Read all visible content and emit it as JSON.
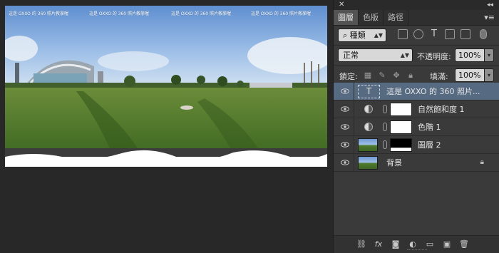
{
  "canvas": {
    "overlay_texts": [
      "這是 OXXO 的 360 照片教學喔",
      "這是 OXXO 的 360 照片教學喔",
      "這是 OXXO 的 360 照片教學喔",
      "這是 OXXO 的 360 照片教學喔"
    ]
  },
  "panel": {
    "close_glyph": "✕",
    "collapse_glyph": "◂◂",
    "menu_glyph": "▾≡",
    "tabs": [
      {
        "label": "圖層",
        "active": true
      },
      {
        "label": "色版",
        "active": false
      },
      {
        "label": "路徑",
        "active": false
      }
    ],
    "filter": {
      "label": "種類",
      "search_glyph": "⌕"
    },
    "blend_mode": {
      "value": "正常",
      "opacity_label": "不透明度:",
      "opacity_value": "100%"
    },
    "lock": {
      "label": "鎖定:",
      "fill_label": "填滿:",
      "fill_value": "100%"
    },
    "layers": [
      {
        "name": "這是 OXXO 的 360 照片...",
        "kind": "text",
        "selected": true,
        "visible": true
      },
      {
        "name": "自然飽和度 1",
        "kind": "adjustment",
        "selected": false,
        "visible": true
      },
      {
        "name": "色階 1",
        "kind": "adjustment",
        "selected": false,
        "visible": true
      },
      {
        "name": "圖層 2",
        "kind": "image-mask",
        "selected": false,
        "visible": true
      },
      {
        "name": "背景",
        "kind": "background",
        "selected": false,
        "visible": true,
        "locked": true
      }
    ],
    "bottom_icons": [
      "link-layers-icon",
      "fx-icon",
      "add-mask-icon",
      "adjustment-icon",
      "group-icon",
      "new-layer-icon",
      "trash-icon"
    ],
    "fx_label": "fx"
  },
  "colors": {
    "selected_row": "#566a82",
    "panel_bg": "#3a3a3a",
    "canvas_bg": "#282828"
  }
}
